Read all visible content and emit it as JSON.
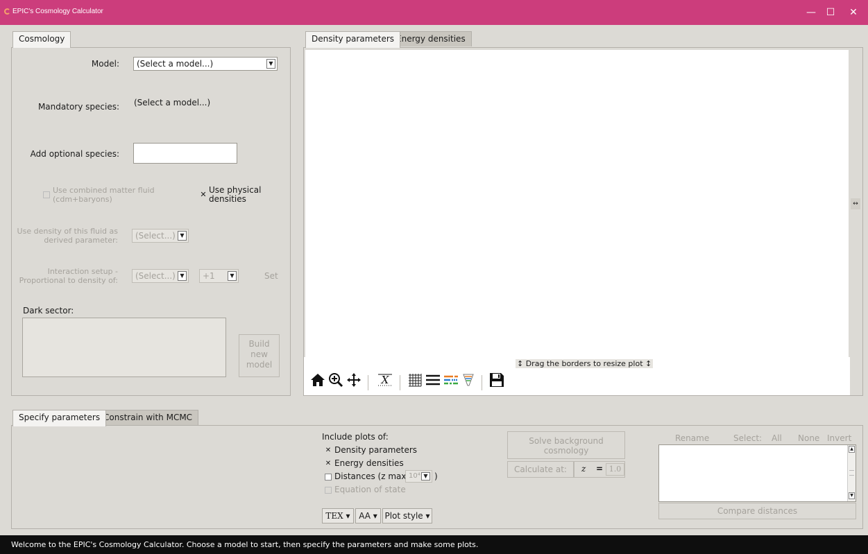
{
  "window": {
    "title": "EPIC's Cosmology Calculator",
    "minimize_glyph": "—",
    "maximize_glyph": "☐",
    "close_glyph": "✕"
  },
  "cosmology_tab": {
    "label": "Cosmology",
    "model_label": "Model:",
    "model_value": "(Select a model...)",
    "mandatory_label": "Mandatory species:",
    "mandatory_value": "(Select a model...)",
    "optional_label": "Add optional species:",
    "optional_value": "",
    "combined_matter_label": "Use combined matter fluid (cdm+baryons)",
    "combined_matter_checked": false,
    "physical_densities_label": "Use physical densities",
    "physical_densities_checked": true,
    "derived_param_label": "Use density of this fluid as derived parameter:",
    "derived_param_value": "(Select...)",
    "interaction_label": "Interaction setup - Proportional to density of:",
    "interaction_value": "(Select...)",
    "interaction_sign": "+1",
    "set_label": "Set",
    "dark_sector_label": "Dark sector:",
    "build_button": "Build new model"
  },
  "plot_area": {
    "tabs": [
      "Density parameters",
      "Energy densities"
    ],
    "active_tab": 0,
    "resize_hint": "↕ Drag the borders to resize plot ↕",
    "side_handle": "↔",
    "toolbar_icons": [
      "home-icon",
      "zoom-icon",
      "pan-icon",
      "x-axis-icon",
      "grid-icon",
      "lines-icon",
      "legend-icon",
      "filter-icon",
      "save-icon"
    ]
  },
  "bottom_tabs": [
    "Specify parameters",
    "Constrain with MCMC"
  ],
  "plots": {
    "include_label": "Include plots of:",
    "density_parameters": "Density parameters",
    "density_parameters_checked": true,
    "energy_densities": "Energy densities",
    "energy_densities_checked": true,
    "distances": "Distances (z max:",
    "distances_checked": false,
    "distances_zmax": "10⁴",
    "distances_close": ")",
    "equation_of_state": "Equation of state",
    "equation_of_state_checked": false,
    "tex_button": "TEX",
    "font_button": "AA",
    "plot_style_button": "Plot style"
  },
  "solve": {
    "solve_button": "Solve background cosmology",
    "calculate_button": "Calculate at:",
    "z_symbol": "z",
    "equals": "=",
    "z_value": "1.0"
  },
  "results": {
    "rename": "Rename",
    "select": "Select:",
    "all": "All",
    "none": "None",
    "invert": "Invert",
    "compare_button": "Compare distances"
  },
  "status": "Welcome to the EPIC's Cosmology Calculator. Choose a model to start, then specify the parameters and make some plots.",
  "colors": {
    "titlebar": "#cc3d7c",
    "window_bg": "#dcdad5",
    "statusbar": "#0e0e0e"
  }
}
